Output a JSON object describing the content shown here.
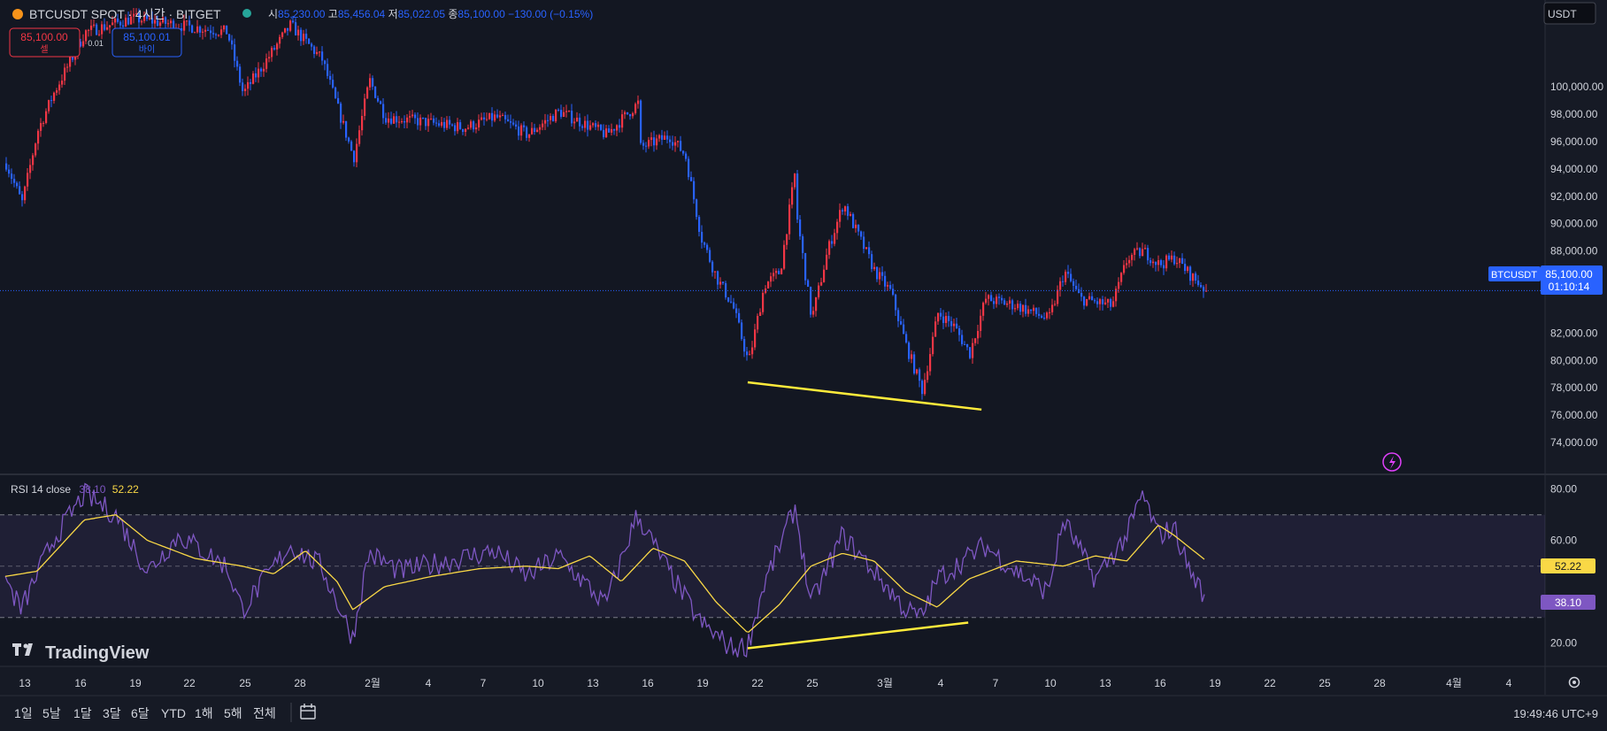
{
  "colors": {
    "background": "#161a25",
    "up": "#f23645",
    "down": "#2962ff",
    "rsi_line": "#7e57c2",
    "rsi_ma": "#f9d846",
    "trendline": "#ffeb3b",
    "grid_text": "#d1d4dc",
    "price_badge": "#2962ff",
    "rsi_band": "#7e57c2"
  },
  "header": {
    "symbol_title": "BTCUSDT SPOT · 4시간 · BITGET",
    "ohlc": {
      "o_label": "시",
      "o_value": "85,230.00",
      "h_label": "고",
      "h_value": "85,456.04",
      "l_label": "저",
      "l_value": "85,022.05",
      "c_label": "종",
      "c_value": "85,100.00",
      "change": "−130.00 (−0.15%)"
    },
    "sell": {
      "price": "85,100.00",
      "label": "셀"
    },
    "spread": "0.01",
    "buy": {
      "price": "85,100.01",
      "label": "바이"
    },
    "currency": "USDT"
  },
  "price_scale": {
    "ticks": [
      "100,000.00",
      "98,000.00",
      "96,000.00",
      "94,000.00",
      "92,000.00",
      "90,000.00",
      "88,000.00",
      "86,000.00",
      "82,000.00",
      "80,000.00",
      "78,000.00",
      "76,000.00",
      "74,000.00"
    ],
    "symbol_badge": "BTCUSDT",
    "last_price": "85,100.00",
    "countdown": "01:10:14"
  },
  "rsi_panel": {
    "label": "RSI 14 close",
    "rsi_value": "38.10",
    "ma_value": "52.22",
    "ticks": [
      "80.00",
      "60.00",
      "20.00"
    ]
  },
  "time_axis": {
    "labels": [
      "13",
      "16",
      "19",
      "22",
      "25",
      "28",
      "2월",
      "4",
      "7",
      "10",
      "13",
      "16",
      "19",
      "22",
      "25",
      "3월",
      "4",
      "7",
      "10",
      "13",
      "16",
      "19",
      "22",
      "25",
      "28",
      "4월",
      "4"
    ]
  },
  "watermark": "TradingView",
  "bottom_bar": {
    "timeframes": [
      "1일",
      "5날",
      "1달",
      "3달",
      "6달",
      "YTD",
      "1해",
      "5해",
      "전체"
    ],
    "clock": "19:49:46 UTC+9"
  },
  "chart_data": [
    {
      "type": "candlestick",
      "symbol": "BTCUSDT",
      "interval": "4h",
      "ylim": [
        73000,
        100500
      ],
      "x_labels": [
        "13",
        "16",
        "19",
        "22",
        "25",
        "28",
        "2월",
        "4",
        "7",
        "10",
        "13",
        "16",
        "19",
        "22",
        "25",
        "3월",
        "4",
        "7",
        "10",
        "13",
        "16",
        "19",
        "22",
        "25",
        "28",
        "4월",
        "4"
      ],
      "close_path": [
        {
          "x": "Jan 12",
          "y": 94400
        },
        {
          "x": "Jan 13",
          "y": 91500
        },
        {
          "x": "Jan 14",
          "y": 96800
        },
        {
          "x": "Jan 15",
          "y": 99500
        },
        {
          "x": "Jan 17",
          "y": 104000
        },
        {
          "x": "Jan 20",
          "y": 105000
        },
        {
          "x": "Jan 23",
          "y": 104500
        },
        {
          "x": "Jan 26",
          "y": 104000
        },
        {
          "x": "Jan 27",
          "y": 99500
        },
        {
          "x": "Jan 30",
          "y": 104500
        },
        {
          "x": "Feb 1",
          "y": 102000
        },
        {
          "x": "Feb 3",
          "y": 94800
        },
        {
          "x": "Feb 4",
          "y": 100500
        },
        {
          "x": "Feb 5",
          "y": 97800
        },
        {
          "x": "Feb 7",
          "y": 97500
        },
        {
          "x": "Feb 10",
          "y": 97000
        },
        {
          "x": "Feb 12",
          "y": 97800
        },
        {
          "x": "Feb 14",
          "y": 96500
        },
        {
          "x": "Feb 16",
          "y": 98200
        },
        {
          "x": "Feb 19",
          "y": 96500
        },
        {
          "x": "Feb 21",
          "y": 98800
        },
        {
          "x": "Feb 21",
          "y": 95500
        },
        {
          "x": "Feb 23",
          "y": 96400
        },
        {
          "x": "Feb 24",
          "y": 95000
        },
        {
          "x": "Feb 25",
          "y": 89000
        },
        {
          "x": "Feb 26",
          "y": 86000
        },
        {
          "x": "Feb 27",
          "y": 84000
        },
        {
          "x": "Feb 28",
          "y": 79800
        },
        {
          "x": "Mar 1",
          "y": 85500
        },
        {
          "x": "Mar 2",
          "y": 86500
        },
        {
          "x": "Mar 3",
          "y": 94200
        },
        {
          "x": "Mar 3",
          "y": 91000
        },
        {
          "x": "Mar 4",
          "y": 83000
        },
        {
          "x": "Mar 5",
          "y": 88000
        },
        {
          "x": "Mar 6",
          "y": 91500
        },
        {
          "x": "Mar 7",
          "y": 89000
        },
        {
          "x": "Mar 8",
          "y": 86500
        },
        {
          "x": "Mar 9",
          "y": 85000
        },
        {
          "x": "Mar 10",
          "y": 81000
        },
        {
          "x": "Mar 11",
          "y": 77800
        },
        {
          "x": "Mar 12",
          "y": 83500
        },
        {
          "x": "Mar 13",
          "y": 82500
        },
        {
          "x": "Mar 14",
          "y": 80500
        },
        {
          "x": "Mar 15",
          "y": 84500
        },
        {
          "x": "Mar 17",
          "y": 84000
        },
        {
          "x": "Mar 19",
          "y": 83000
        },
        {
          "x": "Mar 20",
          "y": 86500
        },
        {
          "x": "Mar 21",
          "y": 84500
        },
        {
          "x": "Mar 23",
          "y": 84000
        },
        {
          "x": "Mar 24",
          "y": 87500
        },
        {
          "x": "Mar 25",
          "y": 88000
        },
        {
          "x": "Mar 26",
          "y": 87000
        },
        {
          "x": "Mar 27",
          "y": 87500
        },
        {
          "x": "Mar 28",
          "y": 86200
        },
        {
          "x": "Mar 29",
          "y": 85100
        }
      ],
      "current_price": 85100,
      "annotations": [
        {
          "type": "trendline",
          "from": {
            "x": "Feb 28",
            "y": 78400
          },
          "to": {
            "x": "Mar 12",
            "y": 76600
          }
        }
      ]
    },
    {
      "type": "line",
      "title": "RSI 14 close",
      "ylim": [
        13,
        87
      ],
      "bands": [
        30,
        50,
        70
      ],
      "series": [
        {
          "name": "RSI",
          "values": [
            {
              "x": "Jan 12",
              "y": 45
            },
            {
              "x": "Jan 13",
              "y": 33
            },
            {
              "x": "Jan 15",
              "y": 60
            },
            {
              "x": "Jan 17",
              "y": 78
            },
            {
              "x": "Jan 19",
              "y": 70
            },
            {
              "x": "Jan 21",
              "y": 48
            },
            {
              "x": "Jan 23",
              "y": 62
            },
            {
              "x": "Jan 26",
              "y": 50
            },
            {
              "x": "Jan 27",
              "y": 33
            },
            {
              "x": "Jan 30",
              "y": 58
            },
            {
              "x": "Feb 1",
              "y": 50
            },
            {
              "x": "Feb 3",
              "y": 22
            },
            {
              "x": "Feb 4",
              "y": 55
            },
            {
              "x": "Feb 6",
              "y": 48
            },
            {
              "x": "Feb 9",
              "y": 52
            },
            {
              "x": "Feb 12",
              "y": 56
            },
            {
              "x": "Feb 14",
              "y": 46
            },
            {
              "x": "Feb 16",
              "y": 54
            },
            {
              "x": "Feb 19",
              "y": 35
            },
            {
              "x": "Feb 21",
              "y": 70
            },
            {
              "x": "Feb 23",
              "y": 48
            },
            {
              "x": "Feb 25",
              "y": 28
            },
            {
              "x": "Feb 27",
              "y": 18
            },
            {
              "x": "Feb 28",
              "y": 19
            },
            {
              "x": "Mar 1",
              "y": 42
            },
            {
              "x": "Mar 3",
              "y": 73
            },
            {
              "x": "Mar 4",
              "y": 35
            },
            {
              "x": "Mar 6",
              "y": 62
            },
            {
              "x": "Mar 8",
              "y": 48
            },
            {
              "x": "Mar 10",
              "y": 33
            },
            {
              "x": "Mar 11",
              "y": 30
            },
            {
              "x": "Mar 12",
              "y": 45
            },
            {
              "x": "Mar 15",
              "y": 58
            },
            {
              "x": "Mar 17",
              "y": 48
            },
            {
              "x": "Mar 19",
              "y": 40
            },
            {
              "x": "Mar 20",
              "y": 68
            },
            {
              "x": "Mar 22",
              "y": 45
            },
            {
              "x": "Mar 24",
              "y": 62
            },
            {
              "x": "Mar 25",
              "y": 78
            },
            {
              "x": "Mar 26",
              "y": 62
            },
            {
              "x": "Mar 27",
              "y": 65
            },
            {
              "x": "Mar 28",
              "y": 48
            },
            {
              "x": "Mar 29",
              "y": 38.1
            }
          ]
        },
        {
          "name": "RSI MA",
          "values": [
            {
              "x": "Jan 12",
              "y": 46
            },
            {
              "x": "Jan 14",
              "y": 48
            },
            {
              "x": "Jan 17",
              "y": 68
            },
            {
              "x": "Jan 19",
              "y": 70
            },
            {
              "x": "Jan 21",
              "y": 60
            },
            {
              "x": "Jan 24",
              "y": 53
            },
            {
              "x": "Jan 27",
              "y": 50
            },
            {
              "x": "Jan 29",
              "y": 47
            },
            {
              "x": "Jan 31",
              "y": 56
            },
            {
              "x": "Feb 2",
              "y": 44
            },
            {
              "x": "Feb 3",
              "y": 33
            },
            {
              "x": "Feb 5",
              "y": 42
            },
            {
              "x": "Feb 8",
              "y": 46
            },
            {
              "x": "Feb 11",
              "y": 49
            },
            {
              "x": "Feb 14",
              "y": 50
            },
            {
              "x": "Feb 16",
              "y": 49
            },
            {
              "x": "Feb 18",
              "y": 54
            },
            {
              "x": "Feb 20",
              "y": 44
            },
            {
              "x": "Feb 22",
              "y": 57
            },
            {
              "x": "Feb 24",
              "y": 52
            },
            {
              "x": "Feb 26",
              "y": 36
            },
            {
              "x": "Feb 28",
              "y": 24
            },
            {
              "x": "Mar 2",
              "y": 35
            },
            {
              "x": "Mar 4",
              "y": 50
            },
            {
              "x": "Mar 6",
              "y": 55
            },
            {
              "x": "Mar 8",
              "y": 52
            },
            {
              "x": "Mar 10",
              "y": 40
            },
            {
              "x": "Mar 12",
              "y": 34
            },
            {
              "x": "Mar 14",
              "y": 45
            },
            {
              "x": "Mar 17",
              "y": 52
            },
            {
              "x": "Mar 20",
              "y": 50
            },
            {
              "x": "Mar 22",
              "y": 54
            },
            {
              "x": "Mar 24",
              "y": 52
            },
            {
              "x": "Mar 26",
              "y": 66
            },
            {
              "x": "Mar 27",
              "y": 62
            },
            {
              "x": "Mar 29",
              "y": 52.22
            }
          ]
        }
      ],
      "annotations": [
        {
          "type": "trendline",
          "from": {
            "x": "Feb 28",
            "y": 18
          },
          "to": {
            "x": "Mar 12",
            "y": 28
          }
        }
      ]
    }
  ]
}
